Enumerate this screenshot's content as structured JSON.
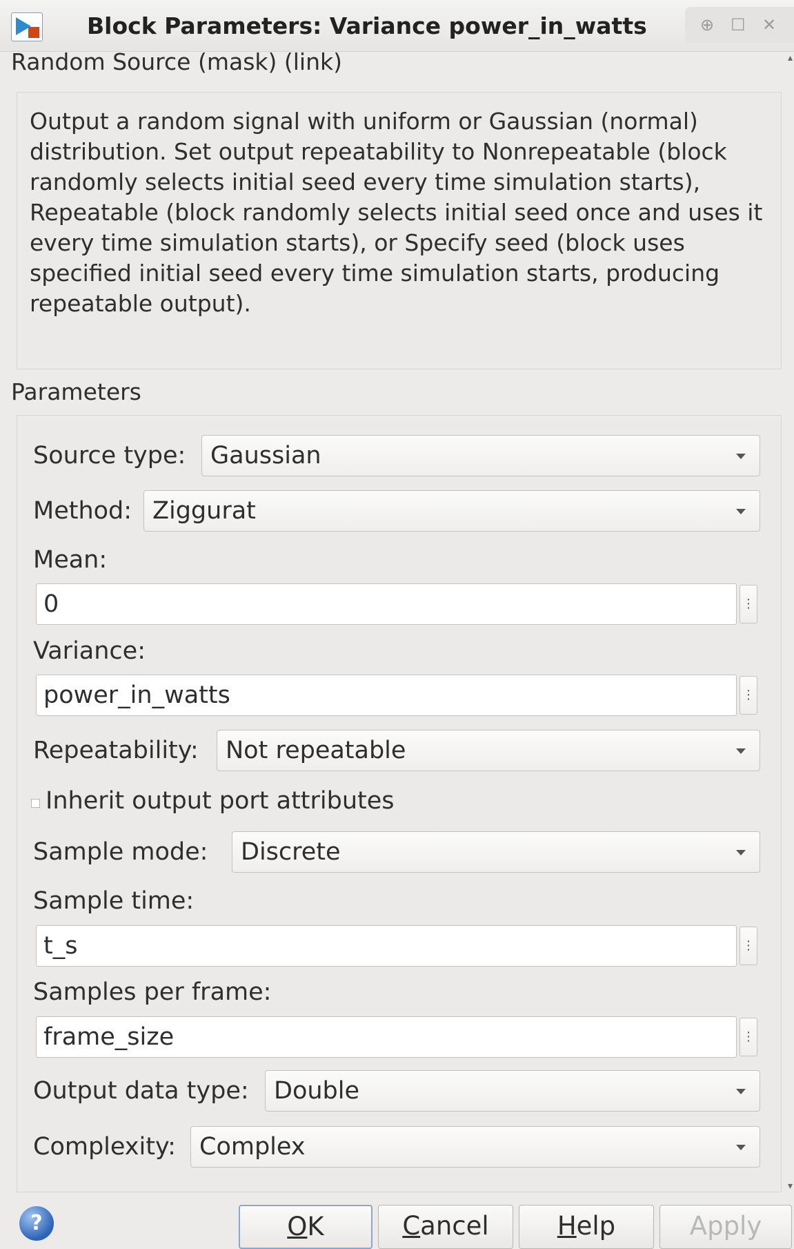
{
  "window": {
    "title": "Block Parameters: Variance power_in_watts",
    "controls": [
      "⊕",
      "☐",
      "✕"
    ]
  },
  "block_type_label": "Random Source (mask) (link)",
  "description": "Output a random signal with uniform or Gaussian (normal) distribution.  Set output repeatability to Nonrepeatable (block randomly selects initial seed every time simulation starts), Repeatable (block randomly selects initial seed once and uses it every time simulation starts), or Specify seed (block uses specified initial seed every time simulation starts, producing repeatable output).",
  "parameters_label": "Parameters",
  "params": {
    "source_type": {
      "label": "Source type:",
      "value": "Gaussian"
    },
    "method": {
      "label": "Method:",
      "value": "Ziggurat"
    },
    "mean": {
      "label": "Mean:",
      "value": "0"
    },
    "variance": {
      "label": "Variance:",
      "value": "power_in_watts"
    },
    "repeatability": {
      "label": "Repeatability:",
      "value": "Not repeatable"
    },
    "inherit": {
      "label": "Inherit output port attributes",
      "checked": false
    },
    "sample_mode": {
      "label": "Sample mode:",
      "value": "Discrete"
    },
    "sample_time": {
      "label": "Sample time:",
      "value": "t_s"
    },
    "samples_per_frame": {
      "label": "Samples per frame:",
      "value": "frame_size"
    },
    "output_data_type": {
      "label": "Output data type:",
      "value": "Double"
    },
    "complexity": {
      "label": "Complexity:",
      "value": "Complex"
    }
  },
  "ellipsis_glyph": "⋮",
  "buttons": {
    "ok": {
      "mnemonic": "O",
      "rest": "K",
      "enabled": true
    },
    "cancel": {
      "mnemonic": "C",
      "rest": "ancel",
      "enabled": true
    },
    "help": {
      "mnemonic": "H",
      "rest": "elp",
      "enabled": true
    },
    "apply": {
      "label": "Apply",
      "enabled": false
    }
  },
  "help_icon_glyph": "?",
  "colors": {
    "window_bg": "#ecebe9",
    "field_bg": "#ffffff",
    "border": "#c3c2bf",
    "text": "#2e2e2e",
    "disabled_text": "#b8b8b8",
    "accent": "#2f8bd0"
  }
}
